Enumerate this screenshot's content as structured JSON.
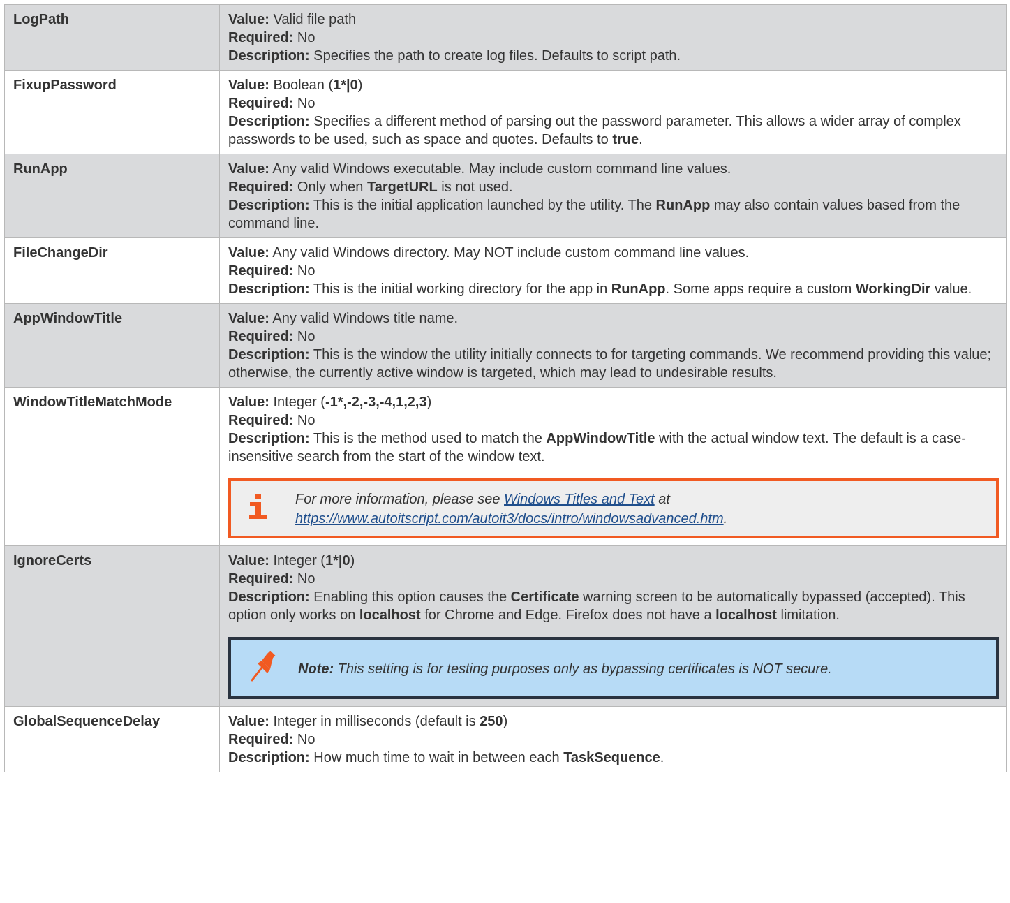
{
  "rows": [
    {
      "name": "LogPath",
      "value_label": "Value:",
      "value": "Valid file path",
      "required_label": "Required:",
      "required": "No",
      "description_label": "Description:",
      "description": "Specifies the path to create log files. Defaults to script path."
    },
    {
      "name": "FixupPassword",
      "value_label": "Value:",
      "value_pre": "Boolean (",
      "value_bold": "1*|0",
      "value_post": ")",
      "required_label": "Required:",
      "required": "No",
      "description_label": "Description:",
      "description_pre": "Specifies a different method of parsing out the password parameter. This allows a wider array of complex passwords to be used, such as space and quotes. Defaults to ",
      "description_bold": "true",
      "description_post": "."
    },
    {
      "name": "RunApp",
      "value_label": "Value:",
      "value": "Any valid Windows executable. May include custom command line values.",
      "required_label": "Required:",
      "required_pre": "Only when ",
      "required_bold": "TargetURL",
      "required_post": " is not used.",
      "description_label": "Description:",
      "description_pre": "This is the initial application launched by the utility. The ",
      "description_bold": "RunApp",
      "description_post": " may also contain values based from the command line."
    },
    {
      "name": "FileChangeDir",
      "value_label": "Value:",
      "value": "Any valid Windows directory. May NOT include custom command line values.",
      "required_label": "Required:",
      "required": "No",
      "description_label": "Description:",
      "description_pre": "This is the initial working directory for the app in ",
      "description_bold": "RunApp",
      "description_mid": ". Some apps require a custom ",
      "description_bold2": "WorkingDir",
      "description_post": " value."
    },
    {
      "name": "AppWindowTitle",
      "value_label": "Value:",
      "value": "Any valid Windows title name.",
      "required_label": "Required:",
      "required": "No",
      "description_label": "Description:",
      "description": "This is the window the utility initially connects to for targeting commands. We recommend providing this value; otherwise, the currently active window is targeted, which may lead to undesirable results."
    },
    {
      "name": "WindowTitleMatchMode",
      "value_label": "Value:",
      "value_pre": "Integer (",
      "value_bold": "-1*,-2,-3,-4,1,2,3",
      "value_post": ")",
      "required_label": "Required:",
      "required": "No",
      "description_label": "Description:",
      "description_pre": "This is the method used to match the ",
      "description_bold": "AppWindowTitle",
      "description_post": " with the actual window text. The default is a case-insensitive search from the start of the window text.",
      "note": {
        "icon": "info-icon",
        "text_pre": "For more information, please see ",
        "link1": "Windows Titles and Text",
        "text_mid": " at ",
        "link2": "https://www.autoitscript.com/autoit3/docs/intro/windowsadvanced.htm",
        "text_post": "."
      }
    },
    {
      "name": "IgnoreCerts",
      "value_label": "Value:",
      "value_pre": "Integer (",
      "value_bold": "1*|0",
      "value_post": ")",
      "required_label": "Required:",
      "required": "No",
      "description_label": "Description:",
      "description_pre": "Enabling this option causes the ",
      "description_bold": "Certificate",
      "description_mid": " warning screen to be automatically bypassed (accepted). This option only works on ",
      "description_bold2": "localhost",
      "description_mid2": " for Chrome and Edge. Firefox does not have a ",
      "description_bold3": "localhost",
      "description_post": " limitation.",
      "warning": {
        "icon": "pushpin-icon",
        "label": "Note:",
        "text": " This setting is for testing purposes only as bypassing certificates is NOT secure."
      }
    },
    {
      "name": "GlobalSequenceDelay",
      "value_label": "Value:",
      "value_pre": "Integer in milliseconds (default is ",
      "value_bold": "250",
      "value_post": ")",
      "required_label": "Required:",
      "required": "No",
      "description_label": "Description:",
      "description_pre": "How much time to wait in between each ",
      "description_bold": "TaskSequence",
      "description_post": "."
    }
  ],
  "colors": {
    "shaded_row": "#d9dadc",
    "note_border": "#f15a22",
    "warning_border": "#2a3340",
    "warning_bg": "#b7dbf6",
    "link": "#1f4e8c"
  }
}
